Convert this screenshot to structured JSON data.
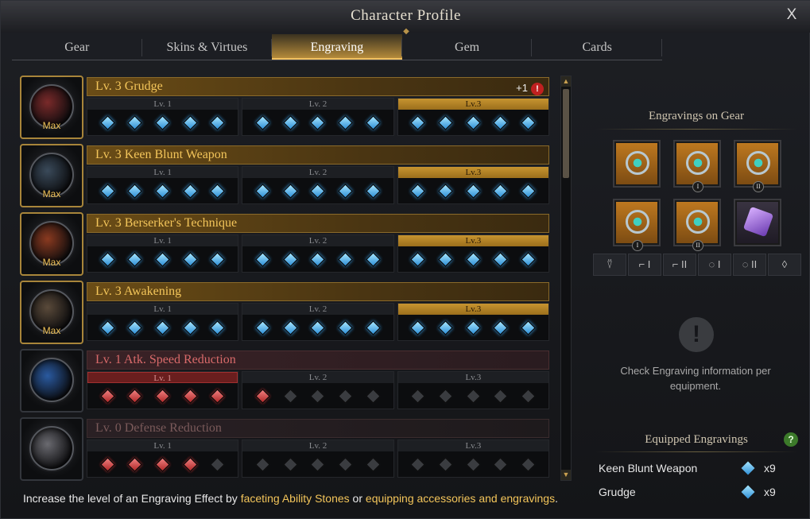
{
  "window": {
    "title": "Character Profile",
    "close_label": "X"
  },
  "tabs": [
    {
      "label": "Gear"
    },
    {
      "label": "Skins & Virtues"
    },
    {
      "label": "Engraving",
      "active": true
    },
    {
      "label": "Gem"
    },
    {
      "label": "Cards"
    }
  ],
  "engravings": [
    {
      "name": "Lv. 3 Grudge",
      "badge": "Max",
      "style": "gold",
      "bonus": "+1",
      "bonus_alert": "!",
      "levels": [
        "Lv. 1",
        "Lv. 2",
        "Lv.3"
      ],
      "active_level": 3,
      "filled": 15,
      "node_color": "blue"
    },
    {
      "name": "Lv. 3 Keen Blunt Weapon",
      "badge": "Max",
      "style": "gold",
      "levels": [
        "Lv. 1",
        "Lv. 2",
        "Lv.3"
      ],
      "active_level": 3,
      "filled": 15,
      "node_color": "blue"
    },
    {
      "name": "Lv. 3 Berserker's Technique",
      "badge": "Max",
      "style": "gold",
      "levels": [
        "Lv. 1",
        "Lv. 2",
        "Lv.3"
      ],
      "active_level": 3,
      "filled": 15,
      "node_color": "blue"
    },
    {
      "name": "Lv. 3 Awakening",
      "badge": "Max",
      "style": "gold",
      "levels": [
        "Lv. 1",
        "Lv. 2",
        "Lv.3"
      ],
      "active_level": 3,
      "filled": 15,
      "node_color": "blue"
    },
    {
      "name": "Lv. 1 Atk. Speed Reduction",
      "badge": "",
      "style": "red",
      "levels": [
        "Lv. 1",
        "Lv. 2",
        "Lv.3"
      ],
      "active_level": 1,
      "filled": 6,
      "node_color": "red"
    },
    {
      "name": "Lv. 0 Defense Reduction",
      "badge": "",
      "style": "dim",
      "levels": [
        "Lv. 1",
        "Lv. 2",
        "Lv.3"
      ],
      "active_level": 0,
      "filled": 4,
      "node_color": "red"
    }
  ],
  "footer": {
    "prefix": "Increase the level of an Engraving Effect by ",
    "link1": "faceting Ability Stones",
    "middle": " or ",
    "link2": "equipping accessories and engravings",
    "suffix": "."
  },
  "gear_panel": {
    "title": "Engravings on Gear",
    "items": [
      {
        "name": "necklace",
        "tag": ""
      },
      {
        "name": "earring-1",
        "tag": "I"
      },
      {
        "name": "earring-2",
        "tag": "II"
      },
      {
        "name": "ring-1",
        "tag": "I"
      },
      {
        "name": "ring-2",
        "tag": "II"
      },
      {
        "name": "ability-stone",
        "tag": ""
      }
    ],
    "slots": [
      {
        "label": "⍢"
      },
      {
        "label": "⌐ I"
      },
      {
        "label": "⌐ II"
      },
      {
        "label": "◌ I"
      },
      {
        "label": "◌ II"
      },
      {
        "label": "◊"
      }
    ],
    "info_symbol": "!",
    "info_text": "Check Engraving information per equipment."
  },
  "equipped": {
    "title": "Equipped Engravings",
    "help": "?",
    "items": [
      {
        "name": "Keen Blunt Weapon",
        "count": "x9"
      },
      {
        "name": "Grudge",
        "count": "x9"
      }
    ]
  }
}
